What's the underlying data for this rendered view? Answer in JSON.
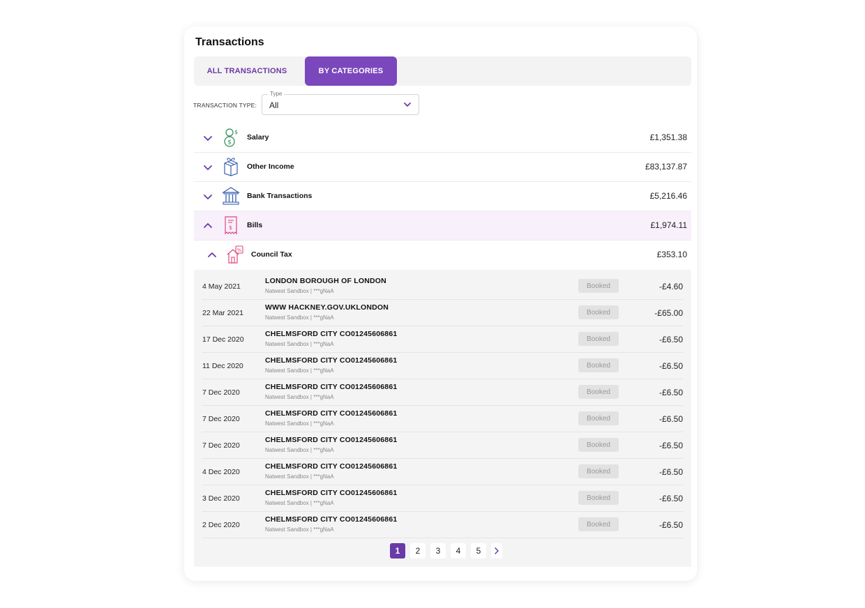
{
  "title": "Transactions",
  "tabs": [
    {
      "label": "ALL TRANSACTIONS",
      "active": false
    },
    {
      "label": "BY CATEGORIES",
      "active": true
    }
  ],
  "filter": {
    "label": "TRANSACTION TYPE:",
    "select_legend": "Type",
    "select_value": "All"
  },
  "categories": [
    {
      "name": "Salary",
      "amount": "£1,351.38",
      "icon": "salary-person-dollar-icon",
      "expanded": false
    },
    {
      "name": "Other Income",
      "amount": "£83,137.87",
      "icon": "gift-box-icon",
      "expanded": false
    },
    {
      "name": "Bank Transactions",
      "amount": "£5,216.46",
      "icon": "bank-building-icon",
      "expanded": false
    },
    {
      "name": "Bills",
      "amount": "£1,974.11",
      "icon": "bill-receipt-icon",
      "expanded": true
    }
  ],
  "subcategory": {
    "name": "Council Tax",
    "amount": "£353.10",
    "icon": "house-percent-icon",
    "expanded": true
  },
  "transactions": [
    {
      "date": "4 May 2021",
      "merchant": "LONDON BOROUGH OF LONDON",
      "source": "Natwest Sandbox | ***gNaA",
      "status": "Booked",
      "amount": "-£4.60"
    },
    {
      "date": "22 Mar 2021",
      "merchant": "WWW HACKNEY.GOV.UKLONDON",
      "source": "Natwest Sandbox | ***gNaA",
      "status": "Booked",
      "amount": "-£65.00"
    },
    {
      "date": "17 Dec 2020",
      "merchant": "CHELMSFORD CITY CO01245606861",
      "source": "Natwest Sandbox | ***gNaA",
      "status": "Booked",
      "amount": "-£6.50"
    },
    {
      "date": "11 Dec 2020",
      "merchant": "CHELMSFORD CITY CO01245606861",
      "source": "Natwest Sandbox | ***gNaA",
      "status": "Booked",
      "amount": "-£6.50"
    },
    {
      "date": "7 Dec 2020",
      "merchant": "CHELMSFORD CITY CO01245606861",
      "source": "Natwest Sandbox | ***gNaA",
      "status": "Booked",
      "amount": "-£6.50"
    },
    {
      "date": "7 Dec 2020",
      "merchant": "CHELMSFORD CITY CO01245606861",
      "source": "Natwest Sandbox | ***gNaA",
      "status": "Booked",
      "amount": "-£6.50"
    },
    {
      "date": "7 Dec 2020",
      "merchant": "CHELMSFORD CITY CO01245606861",
      "source": "Natwest Sandbox | ***gNaA",
      "status": "Booked",
      "amount": "-£6.50"
    },
    {
      "date": "4 Dec 2020",
      "merchant": "CHELMSFORD CITY CO01245606861",
      "source": "Natwest Sandbox | ***gNaA",
      "status": "Booked",
      "amount": "-£6.50"
    },
    {
      "date": "3 Dec 2020",
      "merchant": "CHELMSFORD CITY CO01245606861",
      "source": "Natwest Sandbox | ***gNaA",
      "status": "Booked",
      "amount": "-£6.50"
    },
    {
      "date": "2 Dec 2020",
      "merchant": "CHELMSFORD CITY CO01245606861",
      "source": "Natwest Sandbox | ***gNaA",
      "status": "Booked",
      "amount": "-£6.50"
    }
  ],
  "pagination": {
    "pages": [
      "1",
      "2",
      "3",
      "4",
      "5"
    ],
    "current": "1",
    "next_icon": "chevron-right-icon"
  },
  "colors": {
    "accent": "#7b47bd",
    "accent_dark": "#6a3aa7",
    "salary_icon": "#2e8b57",
    "income_icon": "#3a5fb0",
    "bills_icon": "#e0457b"
  }
}
